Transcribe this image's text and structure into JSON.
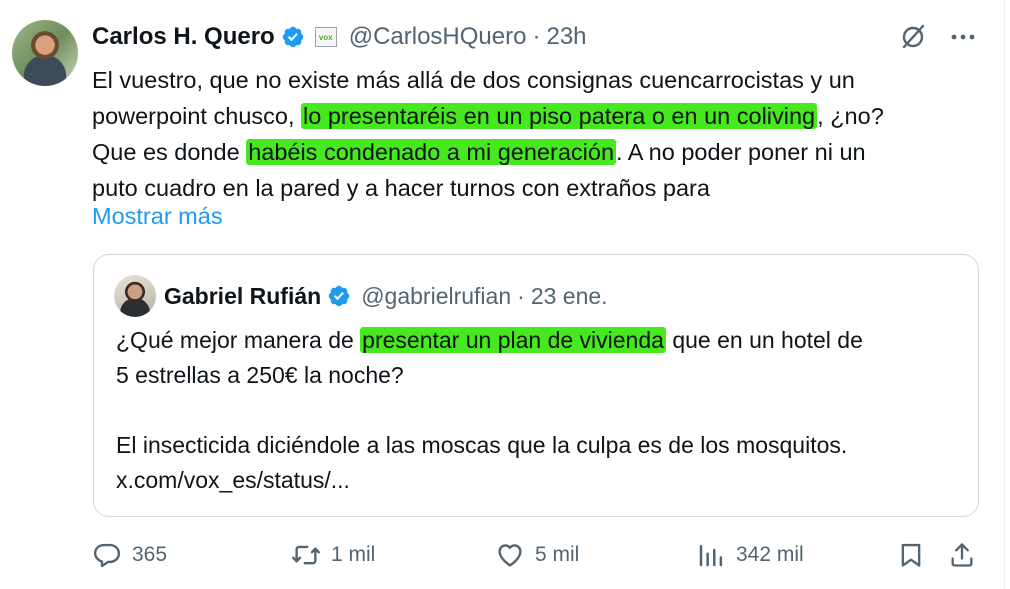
{
  "tweet": {
    "author_name": "Carlos H. Quero",
    "handle": "@CarlosHQuero",
    "separator": "·",
    "time": "23h",
    "badge_text": "vox",
    "lines": [
      {
        "before": "El vuestro, que no existe más allá de dos consignas cuencarrocistas y un",
        "highlight": "",
        "after": ""
      },
      {
        "before": "powerpoint chusco, ",
        "highlight": "lo presentaréis en un piso patera o en un coliving",
        "after": ", ¿no?"
      },
      {
        "before": "Que es donde ",
        "highlight": "habéis condenado a mi generación",
        "after": ". A no poder poner ni un"
      },
      {
        "before": "puto cuadro en la pared y a hacer turnos con extraños para",
        "highlight": "",
        "after": ""
      }
    ],
    "show_more": "Mostrar más"
  },
  "quote": {
    "author_name": "Gabriel Rufián",
    "handle": "@gabrielrufian",
    "separator": "·",
    "date": "23 ene.",
    "line1_before": "¿Qué mejor manera de ",
    "line1_highlight": "presentar un plan de vivienda",
    "line1_after": " que en un hotel de",
    "line2": "5 estrellas a 250€ la noche?",
    "line3": "El insecticida diciéndole a las moscas que la culpa es de los mosquitos.",
    "line4": "x.com/vox_es/status/..."
  },
  "actions": {
    "replies": "365",
    "reposts": "1 mil",
    "likes": "5 mil",
    "views": "342 mil"
  },
  "colors": {
    "highlight": "#46e81e",
    "verified": "#1d9bf0",
    "link": "#1d9bf0",
    "muted": "#536471"
  },
  "icons": [
    "grok-icon",
    "more-icon",
    "reply-icon",
    "repost-icon",
    "like-icon",
    "views-icon",
    "bookmark-icon",
    "share-icon",
    "verified-icon"
  ]
}
